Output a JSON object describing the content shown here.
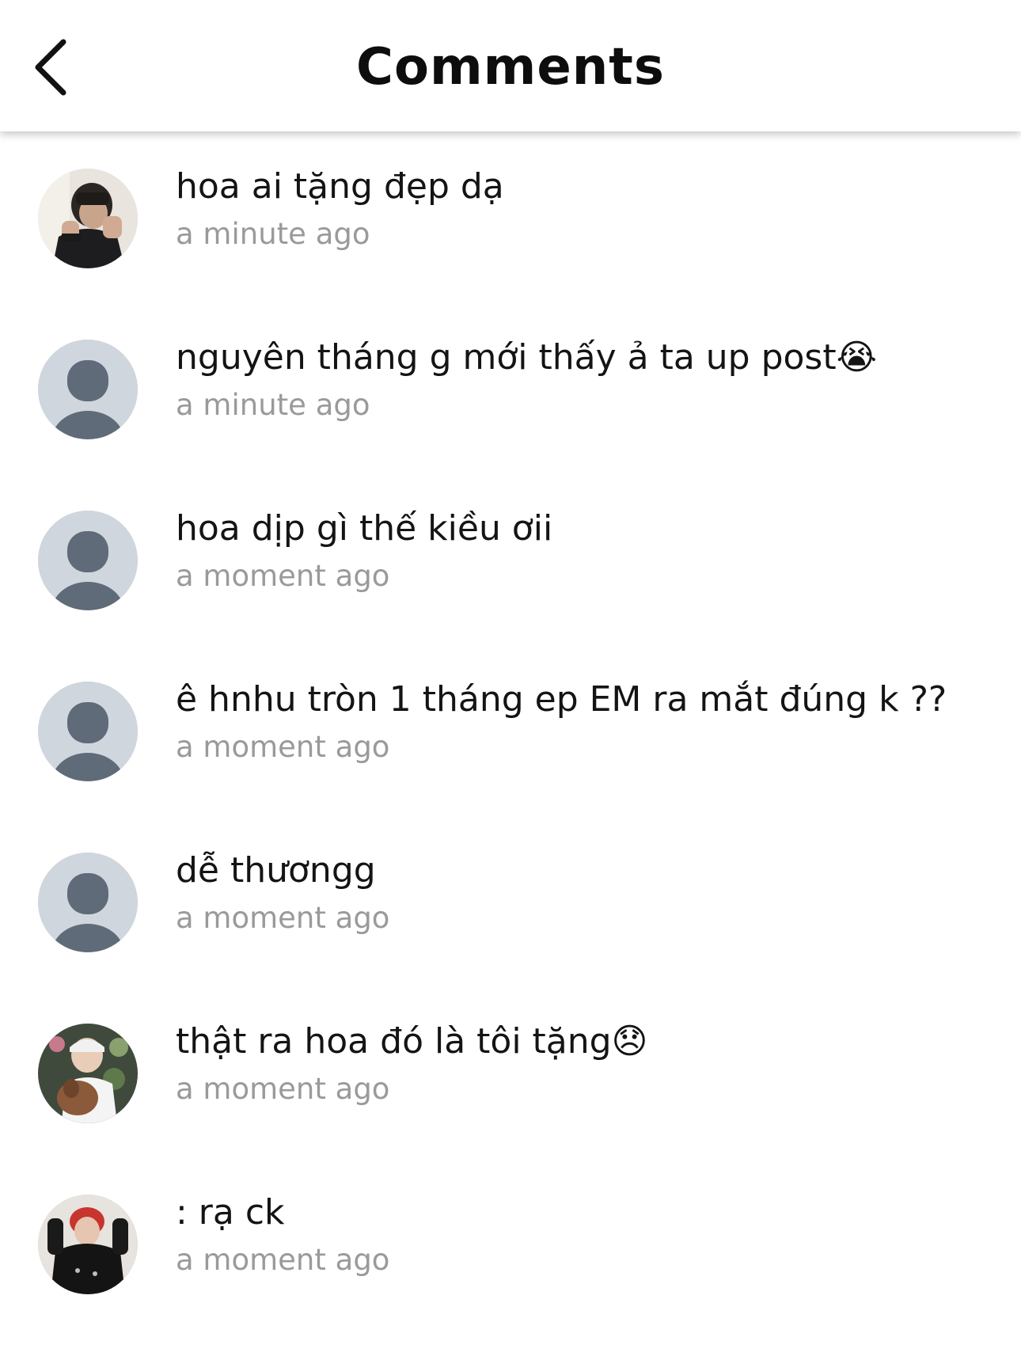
{
  "header": {
    "title": "Comments",
    "back_icon": "chevron-left-icon"
  },
  "comments": [
    {
      "text": "hoa ai tặng đẹp dạ",
      "time": "a minute ago",
      "avatar": "photo"
    },
    {
      "text": "nguyên tháng g mới thấy ả ta up post😭",
      "time": "a minute ago",
      "avatar": "default"
    },
    {
      "text": "hoa dịp gì thế kiều ơii",
      "time": "a moment ago",
      "avatar": "default"
    },
    {
      "text": "ê hnhu tròn 1 tháng ep EM ra mắt đúng k ??",
      "time": "a moment ago",
      "avatar": "default"
    },
    {
      "text": "dễ thươngg",
      "time": "a moment ago",
      "avatar": "default"
    },
    {
      "text": "thật ra hoa đó là tôi tặng😞",
      "time": "a moment ago",
      "avatar": "photo"
    },
    {
      "text": ": rạ ck",
      "time": "a moment ago",
      "avatar": "photo"
    }
  ],
  "colors": {
    "default_avatar_bg": "#cfd6dd",
    "default_avatar_fg": "#5f6b78",
    "time_text": "#9a9a9a"
  }
}
